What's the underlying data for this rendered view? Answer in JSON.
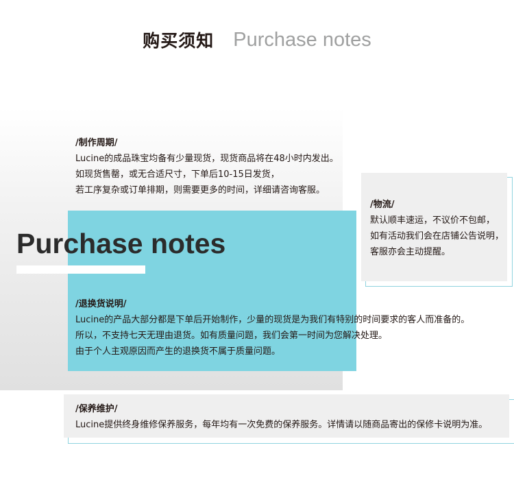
{
  "header": {
    "title_cn": "购买须知",
    "title_en": "Purchase notes"
  },
  "banner": {
    "title": "Purchase notes"
  },
  "sections": {
    "production": {
      "heading": "/制作周期/",
      "lines": [
        "Lucine的成品珠宝均备有少量现货，现货商品将在48小时内发出。",
        "如现货售罄，或无合适尺寸，下单后10-15日发货，",
        "若工序复杂或订单排期，则需要更多的时间，详细请咨询客服。"
      ]
    },
    "logistics": {
      "heading": "/物流/",
      "lines": [
        "默认顺丰速运，不议价不包邮，",
        "如有活动我们会在店铺公告说明，",
        "客服亦会主动提醒。"
      ]
    },
    "returns": {
      "heading": "/退换货说明/",
      "lines": [
        "Lucine的产品大部分都是下单后开始制作，少量的现货是为我们有特别的时间要求的客人而准备的。",
        "所以，不支持七天无理由退货。如有质量问题，我们会第一时间为您解决处理。",
        "由于个人主观原因而产生的退换货不属于质量问题。"
      ]
    },
    "care": {
      "heading": "/保养维护/",
      "lines": [
        "Lucine提供终身维修保养服务，每年均有一次免费的保养服务。详情请以随商品寄出的保修卡说明为准。"
      ]
    }
  },
  "colors": {
    "accent_cyan": "#7fd4e1",
    "outline_cyan": "#8fd3df",
    "box_gray": "#efefef",
    "text_dark": "#231815",
    "subtitle_gray": "#9fa0a0"
  }
}
